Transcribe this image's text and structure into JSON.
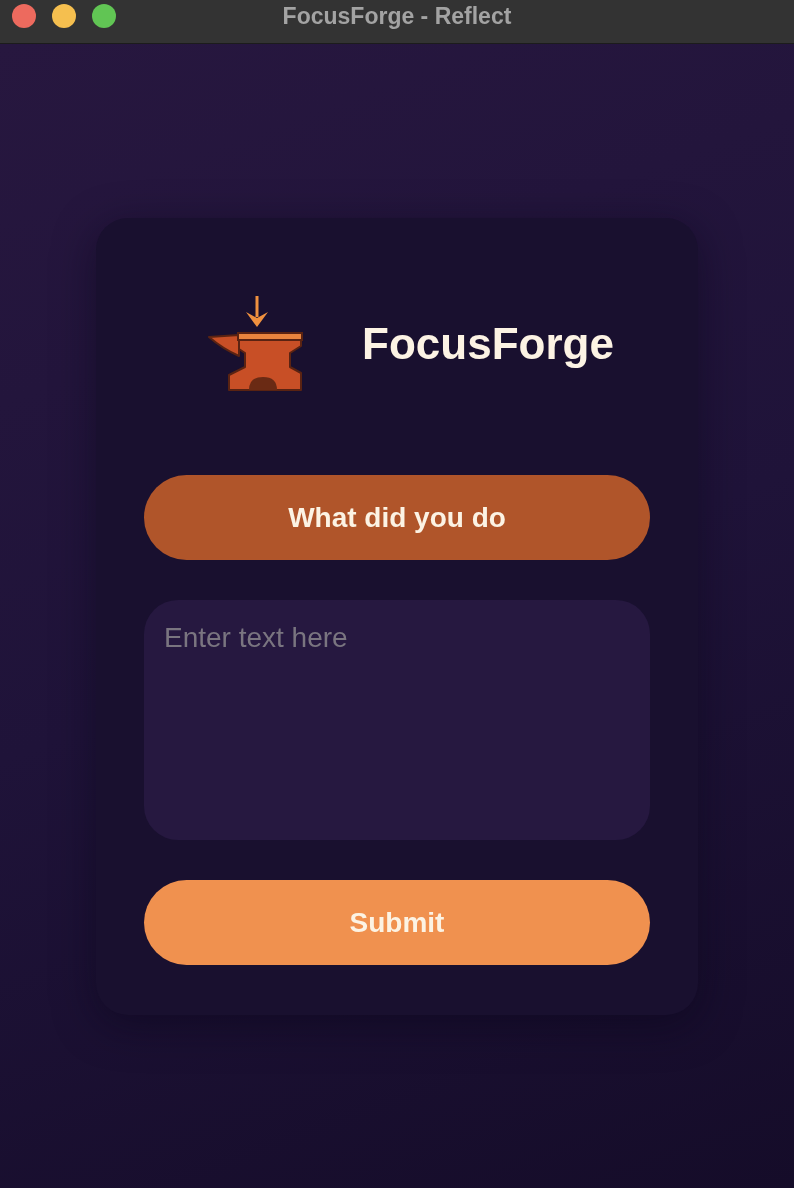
{
  "window": {
    "title": "FocusForge - Reflect"
  },
  "brand": {
    "name": "FocusForge"
  },
  "prompt": {
    "label": "What did you do"
  },
  "entry": {
    "placeholder": "Enter text here"
  },
  "submit": {
    "label": "Submit"
  }
}
